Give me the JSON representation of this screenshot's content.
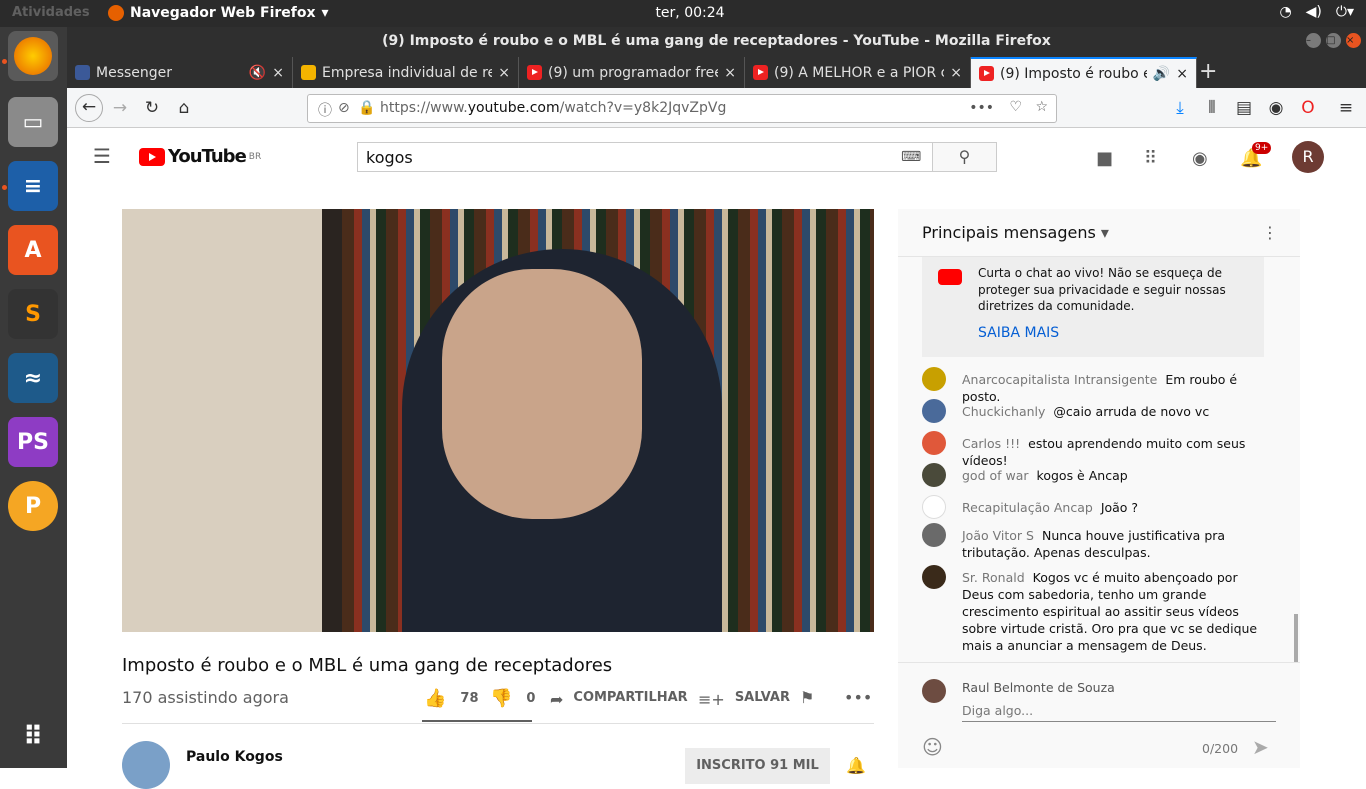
{
  "os": {
    "activities": "Atividades",
    "app_name": "Navegador Web Firefox",
    "clock": "ter, 00:24"
  },
  "window": {
    "title": "(9) Imposto é roubo e o MBL é uma gang de receptadores - YouTube - Mozilla Firefox"
  },
  "tabs": [
    {
      "label": "Messenger"
    },
    {
      "label": "Empresa individual de re"
    },
    {
      "label": "(9) um programador free"
    },
    {
      "label": "(9) A MELHOR e a PIOR c"
    },
    {
      "label": "(9) Imposto é roubo e"
    }
  ],
  "url": {
    "prefix": "https://www.",
    "domain": "youtube.com",
    "path": "/watch?v=y8k2JqvZpVg"
  },
  "youtube": {
    "logo": "YouTube",
    "region": "BR",
    "search_value": "kogos",
    "notif_count": "9+",
    "avatar_letter": "R"
  },
  "video": {
    "title": "Imposto é roubo e o MBL é uma gang de receptadores",
    "viewers": "170 assistindo agora",
    "likes": "78",
    "dislikes": "0",
    "share": "COMPARTILHAR",
    "save": "SALVAR",
    "channel": "Paulo Kogos",
    "subscribed": "INSCRITO 91 MIL"
  },
  "chat": {
    "header": "Principais mensagens",
    "notice": "Curta o chat ao vivo! Não se esqueça de proteger sua privacidade e seguir nossas diretrizes da comunidade.",
    "learn_more": "SAIBA MAIS",
    "messages": [
      {
        "name": "Anarcocapitalista Intransigente",
        "text": "Em roubo é posto."
      },
      {
        "name": "Chuckichanly",
        "text": "@caio arruda de novo vc"
      },
      {
        "name": "Carlos !!!",
        "text": "estou aprendendo muito com seus vídeos!"
      },
      {
        "name": "god of war",
        "text": "kogos è Ancap"
      },
      {
        "name": "Recapitulação Ancap",
        "text": "João ?"
      },
      {
        "name": "João Vitor S",
        "text": "Nunca houve justificativa pra tributação. Apenas desculpas."
      },
      {
        "name": "Sr. Ronald",
        "text": "Kogos vc é muito abençoado por Deus com sabedoria, tenho um grande crescimento espiritual ao assitir seus vídeos sobre virtude cristã. Oro pra que vc se dedique mais a anunciar a mensagem de Deus."
      }
    ],
    "user": "Raul Belmonte de Souza",
    "placeholder": "Diga algo...",
    "counter": "0/200"
  }
}
